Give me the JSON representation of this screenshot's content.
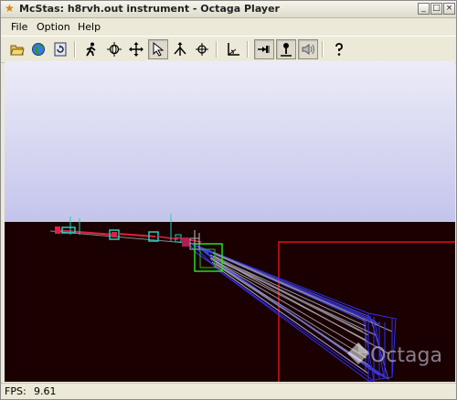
{
  "window": {
    "title": "McStas: h8rvh.out instrument - Octaga Player",
    "title_icon": "star-icon",
    "controls": [
      "minimize-icon",
      "maximize-icon",
      "close-icon"
    ]
  },
  "menu": {
    "items": [
      "File",
      "Option",
      "Help"
    ]
  },
  "toolbar": {
    "buttons": [
      {
        "icon": "open-folder-icon",
        "pressed": false
      },
      {
        "icon": "globe-icon",
        "pressed": false
      },
      {
        "icon": "reload-icon",
        "pressed": false
      },
      {
        "icon": "walk-icon",
        "pressed": false
      },
      {
        "icon": "examine-icon",
        "pressed": false
      },
      {
        "icon": "pan-icon",
        "pressed": false
      },
      {
        "icon": "select-arrow-icon",
        "pressed": true
      },
      {
        "icon": "fly-icon",
        "pressed": false
      },
      {
        "icon": "crosshair-icon",
        "pressed": false
      },
      {
        "icon": "axes-icon",
        "pressed": false
      },
      {
        "icon": "collision-icon",
        "pressed": true
      },
      {
        "icon": "gravity-icon",
        "pressed": true
      },
      {
        "icon": "sound-icon",
        "pressed": true
      },
      {
        "icon": "help-icon",
        "pressed": false
      }
    ]
  },
  "viewport": {
    "sky_top": "#e6e6f8",
    "sky_bottom": "#c8c8ee",
    "ground": "#1a0000",
    "beam_color": "#3333ff",
    "brand": "Octaga"
  },
  "status": {
    "label": "FPS:",
    "value": "9.61"
  }
}
